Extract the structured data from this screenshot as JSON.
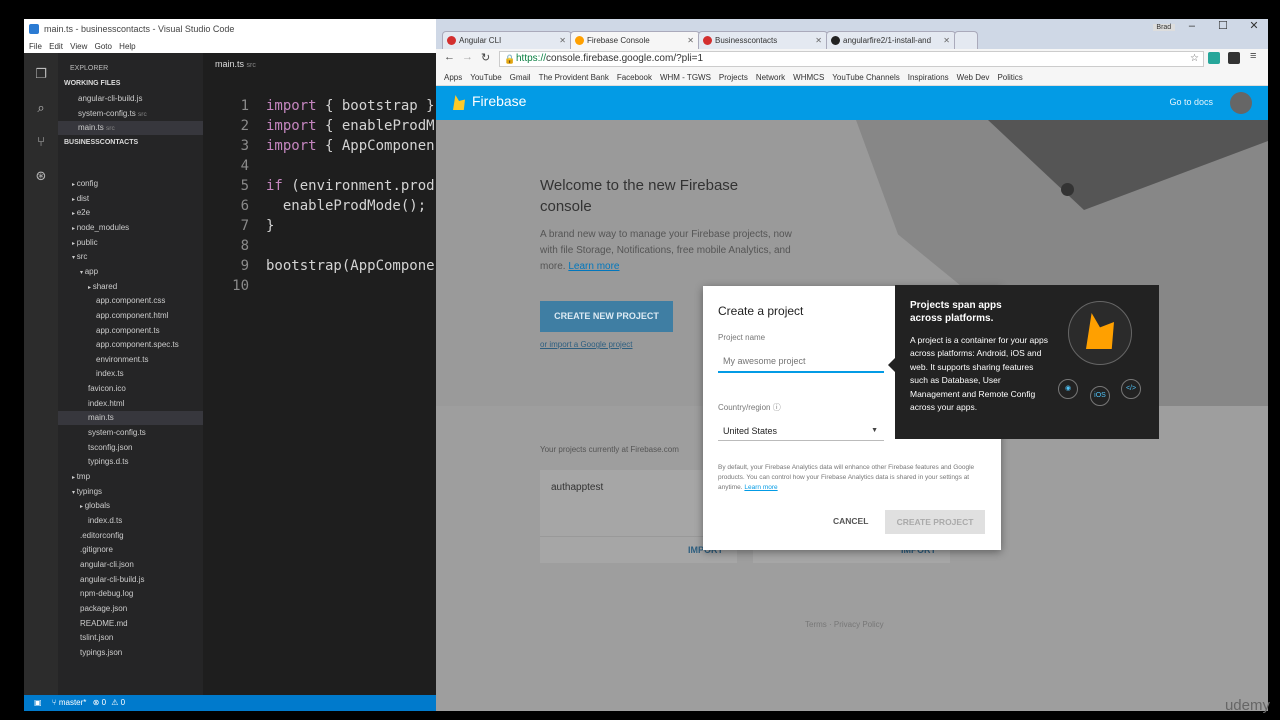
{
  "vscode": {
    "title": "main.ts - businesscontacts - Visual Studio Code",
    "menu": [
      "File",
      "Edit",
      "View",
      "Goto",
      "Help"
    ],
    "explorer_label": "EXPLORER",
    "working_files_label": "WORKING FILES",
    "working_files": [
      {
        "name": "angular-cli-build.js",
        "path": ""
      },
      {
        "name": "system-config.ts",
        "path": "src"
      },
      {
        "name": "main.ts",
        "path": "src"
      }
    ],
    "project_label": "BUSINESSCONTACTS",
    "tree": [
      "config",
      "dist",
      "e2e",
      "node_modules",
      "public",
      "src",
      "app",
      "shared",
      "app.component.css",
      "app.component.html",
      "app.component.ts",
      "app.component.spec.ts",
      "environment.ts",
      "index.ts",
      "favicon.ico",
      "index.html",
      "main.ts",
      "system-config.ts",
      "tsconfig.json",
      "typings.d.ts",
      "tmp",
      "typings",
      "globals",
      "index.d.ts",
      ".editorconfig",
      ".gitignore",
      "angular-cli.json",
      "angular-cli-build.js",
      "npm-debug.log",
      "package.json",
      "README.md",
      "tslint.json",
      "typings.json"
    ],
    "editor_tab": "main.ts",
    "editor_tab_path": "src",
    "code_lines": [
      [
        "import",
        "{ bootstrap }"
      ],
      [
        "import",
        "{ enableProdM"
      ],
      [
        "import",
        "{ AppComponen"
      ],
      [
        "",
        ""
      ],
      [
        "if",
        "(environment.prod"
      ],
      [
        "",
        "  enableProdMode();"
      ],
      [
        "",
        "}"
      ],
      [
        "",
        ""
      ],
      [
        "",
        "bootstrap(AppCompone"
      ],
      [
        "",
        ""
      ]
    ],
    "line_numbers": [
      "1",
      "2",
      "3",
      "4",
      "5",
      "6",
      "7",
      "8",
      "9",
      "10"
    ],
    "status_branch": "master*",
    "status_errors": "0",
    "status_warnings": "0"
  },
  "chrome": {
    "tabs": [
      {
        "label": "Angular CLI",
        "color": "#d32f2f"
      },
      {
        "label": "Firebase Console",
        "color": "#ffa000"
      },
      {
        "label": "Businesscontacts",
        "color": "#d32f2f"
      },
      {
        "label": "angularfire2/1-install-and",
        "color": "#222"
      }
    ],
    "user": "Brad",
    "url_https": "https://",
    "url_rest": "console.firebase.google.com/?pli=1",
    "bookmarks": [
      "Apps",
      "YouTube",
      "Gmail",
      "The Provident Bank",
      "Facebook",
      "WHM - TGWS",
      "Projects",
      "Network",
      "WHMCS",
      "YouTube Channels",
      "Inspirations",
      "Web Dev",
      "Politics"
    ]
  },
  "firebase": {
    "brand": "Firebase",
    "go_to_docs": "Go to docs",
    "welcome": "Welcome to the new Firebase console",
    "lead": "A brand new way to manage your Firebase projects, now with file Storage, Notifications, free mobile Analytics, and more.",
    "learn_more": "Learn more",
    "create_new": "CREATE NEW PROJECT",
    "import_link": "or import a Google project",
    "current_projects": "Your projects currently at Firebase.com",
    "projects": [
      {
        "name": "authapptest",
        "action": "IMPORT"
      },
      {
        "name": "",
        "action": "IMPORT"
      }
    ],
    "footer_terms": "Terms",
    "footer_privacy": "Privacy Policy"
  },
  "dialog": {
    "title": "Create a project",
    "project_name_label": "Project name",
    "project_name_placeholder": "My awesome project",
    "country_label": "Country/region",
    "country_value": "United States",
    "disclaimer": "By default, your Firebase Analytics data will enhance other Firebase features and Google products. You can control how your Firebase Analytics data is shared in your settings at anytime.",
    "disclaimer_link": "Learn more",
    "cancel": "CANCEL",
    "create": "CREATE PROJECT"
  },
  "tooltip": {
    "heading": "Projects span apps across platforms.",
    "body": "A project is a container for your apps across platforms: Android, iOS and web. It supports sharing features such as Database, User Management and Remote Config across your apps.",
    "ios": "iOS",
    "web": "</>"
  },
  "watermark": "udemy"
}
